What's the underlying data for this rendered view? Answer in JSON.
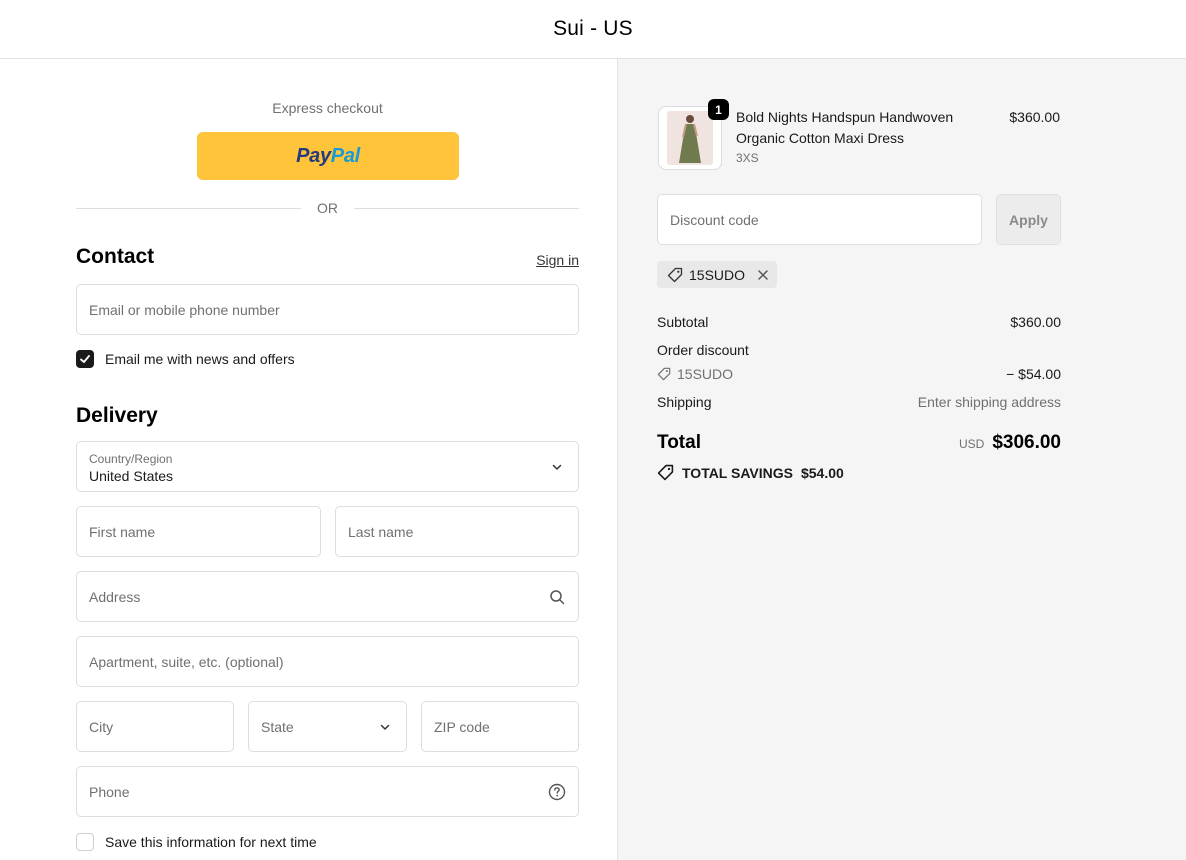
{
  "header": {
    "store_name": "Sui - US"
  },
  "express": {
    "label": "Express checkout",
    "paypal_pay": "Pay",
    "paypal_pal": "Pal",
    "or_text": "OR"
  },
  "contact": {
    "title": "Contact",
    "sign_in": "Sign in",
    "email_placeholder": "Email or mobile phone number",
    "news_label": "Email me with news and offers",
    "news_checked": true
  },
  "delivery": {
    "title": "Delivery",
    "country_label": "Country/Region",
    "country_value": "United States",
    "first_name_placeholder": "First name",
    "last_name_placeholder": "Last name",
    "address_placeholder": "Address",
    "apartment_placeholder": "Apartment, suite, etc. (optional)",
    "city_placeholder": "City",
    "state_placeholder": "State",
    "zip_placeholder": "ZIP code",
    "phone_placeholder": "Phone",
    "save_label": "Save this information for next time",
    "save_checked": false
  },
  "order": {
    "product": {
      "title": "Bold Nights Handspun Handwoven Organic Cotton Maxi Dress",
      "variant": "3XS",
      "price": "$360.00",
      "quantity": "1"
    },
    "discount_placeholder": "Discount code",
    "apply_label": "Apply",
    "applied_code": "15SUDO",
    "subtotal_label": "Subtotal",
    "subtotal_value": "$360.00",
    "order_discount_label": "Order discount",
    "order_discount_code": "15SUDO",
    "order_discount_value": "− $54.00",
    "shipping_label": "Shipping",
    "shipping_value": "Enter shipping address",
    "total_label": "Total",
    "total_currency": "USD",
    "total_value": "$306.00",
    "savings_label": "TOTAL SAVINGS",
    "savings_value": "$54.00"
  },
  "colors": {
    "paypal_yellow": "#ffc439",
    "paypal_dark": "#253b80",
    "paypal_light": "#179bd7",
    "summary_bg": "#f5f5f5"
  }
}
